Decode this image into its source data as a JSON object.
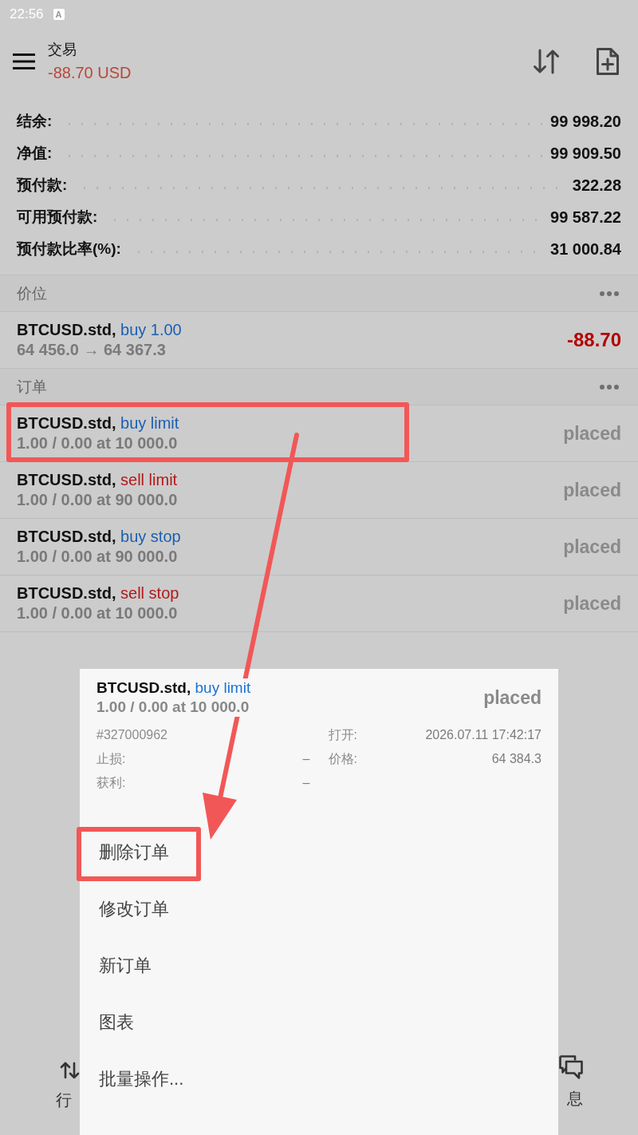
{
  "status_bar": {
    "time": "22:56",
    "badge": "A"
  },
  "app_bar": {
    "title": "交易",
    "subtitle": "-88.70 USD"
  },
  "summary": [
    {
      "label": "结余:",
      "value": "99 998.20"
    },
    {
      "label": "净值:",
      "value": "99 909.50"
    },
    {
      "label": "预付款:",
      "value": "322.28"
    },
    {
      "label": "可用预付款:",
      "value": "99 587.22"
    },
    {
      "label": "预付款比率(%):",
      "value": "31 000.84"
    }
  ],
  "positions": {
    "title": "价位",
    "items": [
      {
        "symbol": "BTCUSD.std,",
        "action": "buy 1.00",
        "color": "#1c5fb2",
        "prices": "64 456.0 → 64 367.3",
        "profit": "-88.70"
      }
    ]
  },
  "orders": {
    "title": "订单",
    "items": [
      {
        "symbol": "BTCUSD.std,",
        "action": "buy limit",
        "color": "#1c5fb2",
        "details": "1.00 / 0.00 at 10 000.0",
        "status": "placed",
        "highlighted": true
      },
      {
        "symbol": "BTCUSD.std,",
        "action": "sell limit",
        "color": "#b2191a",
        "details": "1.00 / 0.00 at 90 000.0",
        "status": "placed",
        "highlighted": false
      },
      {
        "symbol": "BTCUSD.std,",
        "action": "buy stop",
        "color": "#1c5fb2",
        "details": "1.00 / 0.00 at 90 000.0",
        "status": "placed",
        "highlighted": false
      },
      {
        "symbol": "BTCUSD.std,",
        "action": "sell stop",
        "color": "#b2191a",
        "details": "1.00 / 0.00 at 10 000.0",
        "status": "placed",
        "highlighted": false
      }
    ]
  },
  "order_popup": {
    "symbol": "BTCUSD.std,",
    "action": "buy limit",
    "color": "#1a73d2",
    "details": "1.00 / 0.00 at 10 000.0",
    "status": "placed",
    "ticket": "#327000962",
    "left_fields": [
      {
        "label": "止损:",
        "value": "–"
      },
      {
        "label": "获利:",
        "value": "–"
      }
    ],
    "right_fields": [
      {
        "label": "打开:",
        "value": "2026.07.11 17:42:17"
      },
      {
        "label": "价格:",
        "value": "64 384.3"
      }
    ],
    "menu": [
      {
        "label": "删除订单",
        "highlighted": true
      },
      {
        "label": "修改订单",
        "highlighted": false
      },
      {
        "label": "新订单",
        "highlighted": false
      },
      {
        "label": "图表",
        "highlighted": false
      },
      {
        "label": "批量操作...",
        "highlighted": false
      }
    ]
  },
  "bottom_nav": [
    {
      "label": "行",
      "kind": "quotes"
    },
    {
      "label": "息",
      "kind": "messages"
    }
  ]
}
